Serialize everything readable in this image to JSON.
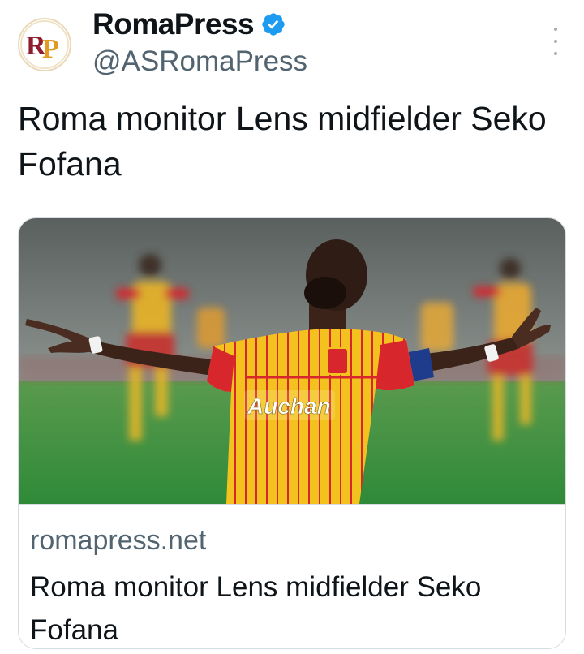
{
  "account": {
    "display_name": "RomaPress",
    "handle": "@ASRomaPress",
    "avatar_initials": "RP",
    "verified": true,
    "verified_color": "#1d9bf0"
  },
  "tweet": {
    "text": "Roma monitor Lens midfielder Seko Fofana"
  },
  "link_card": {
    "image_description": "Lens player with arms outstretched celebrating on the pitch",
    "jersey_sponsor": "Auchan",
    "domain": "romapress.net",
    "title": "Roma monitor Lens midfielder Seko Fofana"
  },
  "colors": {
    "text_primary": "#0f1419",
    "text_secondary": "#536471",
    "card_border": "#d5dbe0",
    "jersey_red": "#d8262d",
    "jersey_yellow": "#f4c21f"
  },
  "icons": {
    "more": "more-vertical-icon",
    "verified": "verified-badge-icon"
  }
}
